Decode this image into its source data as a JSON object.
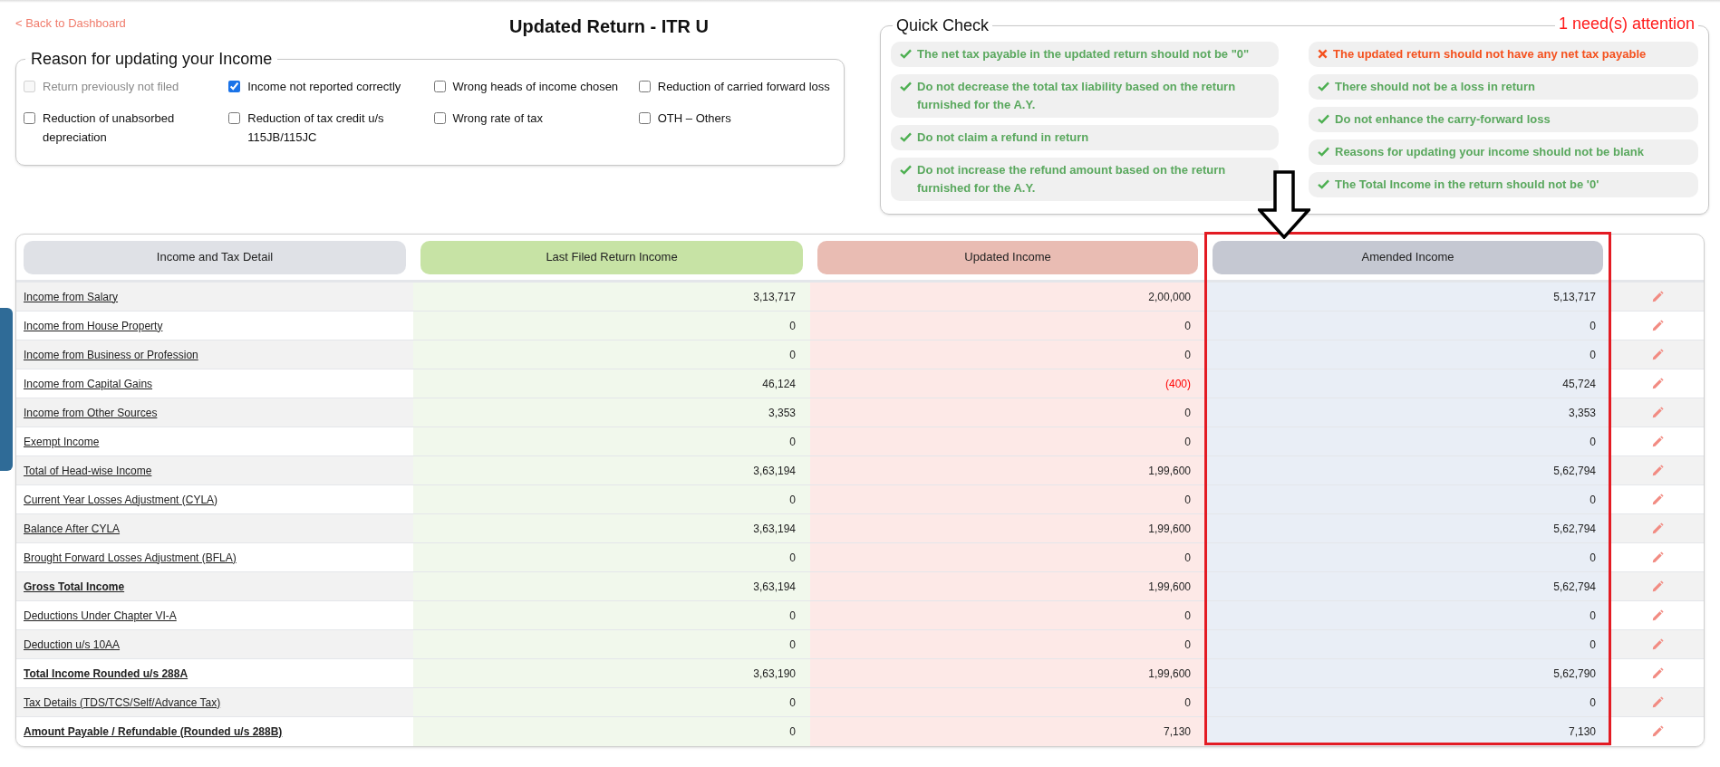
{
  "back_link": "< Back to Dashboard",
  "title": "Updated Return - ITR U",
  "reasons": {
    "legend": "Reason for updating your Income",
    "options": [
      {
        "label": "Return previously not filed",
        "checked": false,
        "disabled": true
      },
      {
        "label": "Income not reported correctly",
        "checked": true,
        "disabled": false
      },
      {
        "label": "Wrong heads of income chosen",
        "checked": false,
        "disabled": false
      },
      {
        "label": "Reduction of carried forward loss",
        "checked": false,
        "disabled": false
      },
      {
        "label": "Reduction of unabsorbed depreciation",
        "checked": false,
        "disabled": false
      },
      {
        "label": "Reduction of tax credit u/s 115JB/115JC",
        "checked": false,
        "disabled": false
      },
      {
        "label": "Wrong rate of tax",
        "checked": false,
        "disabled": false
      },
      {
        "label": "OTH – Others",
        "checked": false,
        "disabled": false
      }
    ]
  },
  "quick_check": {
    "legend": "Quick Check",
    "attention": "1 need(s) attention",
    "columns": [
      [
        {
          "text": "The net tax payable in the updated return should not be \"0\"",
          "passed": true
        },
        {
          "text": "Do not decrease the total tax liability based on the return furnished for the A.Y.",
          "passed": true
        },
        {
          "text": "Do not claim a refund in return",
          "passed": true
        },
        {
          "text": "Do not increase the refund amount based on the return furnished for the A.Y.",
          "passed": true
        }
      ],
      [
        {
          "text": "The updated return should not have any net tax payable",
          "passed": false
        },
        {
          "text": "There should not be a loss in return",
          "passed": true
        },
        {
          "text": "Do not enhance the carry-forward loss",
          "passed": true
        },
        {
          "text": "Reasons for updating your income should not be blank",
          "passed": true
        },
        {
          "text": "The Total Income in the return should not be '0'",
          "passed": true
        }
      ]
    ]
  },
  "table": {
    "columns": [
      {
        "label": "Income and Tax Detail",
        "kind": "label"
      },
      {
        "label": "Last Filed Return Income",
        "kind": "last"
      },
      {
        "label": "Updated Income",
        "kind": "updated"
      },
      {
        "label": "Amended Income",
        "kind": "amended"
      }
    ],
    "rows": [
      {
        "label": "Income from Salary",
        "bold": false,
        "values": [
          {
            "text": "3,13,717",
            "negative": false
          },
          {
            "text": "2,00,000",
            "negative": false
          },
          {
            "text": "5,13,717",
            "negative": false
          }
        ]
      },
      {
        "label": "Income from House Property",
        "bold": false,
        "values": [
          {
            "text": "0",
            "negative": false
          },
          {
            "text": "0",
            "negative": false
          },
          {
            "text": "0",
            "negative": false
          }
        ]
      },
      {
        "label": "Income from Business or Profession",
        "bold": false,
        "values": [
          {
            "text": "0",
            "negative": false
          },
          {
            "text": "0",
            "negative": false
          },
          {
            "text": "0",
            "negative": false
          }
        ]
      },
      {
        "label": "Income from Capital Gains",
        "bold": false,
        "values": [
          {
            "text": "46,124",
            "negative": false
          },
          {
            "text": "(400)",
            "negative": true
          },
          {
            "text": "45,724",
            "negative": false
          }
        ]
      },
      {
        "label": "Income from Other Sources",
        "bold": false,
        "values": [
          {
            "text": "3,353",
            "negative": false
          },
          {
            "text": "0",
            "negative": false
          },
          {
            "text": "3,353",
            "negative": false
          }
        ]
      },
      {
        "label": "Exempt Income",
        "bold": false,
        "values": [
          {
            "text": "0",
            "negative": false
          },
          {
            "text": "0",
            "negative": false
          },
          {
            "text": "0",
            "negative": false
          }
        ]
      },
      {
        "label": "Total of Head-wise Income",
        "bold": false,
        "values": [
          {
            "text": "3,63,194",
            "negative": false
          },
          {
            "text": "1,99,600",
            "negative": false
          },
          {
            "text": "5,62,794",
            "negative": false
          }
        ]
      },
      {
        "label": "Current Year Losses Adjustment (CYLA)",
        "bold": false,
        "values": [
          {
            "text": "0",
            "negative": false
          },
          {
            "text": "0",
            "negative": false
          },
          {
            "text": "0",
            "negative": false
          }
        ]
      },
      {
        "label": "Balance After CYLA",
        "bold": false,
        "values": [
          {
            "text": "3,63,194",
            "negative": false
          },
          {
            "text": "1,99,600",
            "negative": false
          },
          {
            "text": "5,62,794",
            "negative": false
          }
        ]
      },
      {
        "label": "Brought Forward Losses Adjustment (BFLA)",
        "bold": false,
        "values": [
          {
            "text": "0",
            "negative": false
          },
          {
            "text": "0",
            "negative": false
          },
          {
            "text": "0",
            "negative": false
          }
        ]
      },
      {
        "label": "Gross Total Income",
        "bold": true,
        "values": [
          {
            "text": "3,63,194",
            "negative": false
          },
          {
            "text": "1,99,600",
            "negative": false
          },
          {
            "text": "5,62,794",
            "negative": false
          }
        ]
      },
      {
        "label": "Deductions Under Chapter VI-A",
        "bold": false,
        "values": [
          {
            "text": "0",
            "negative": false
          },
          {
            "text": "0",
            "negative": false
          },
          {
            "text": "0",
            "negative": false
          }
        ]
      },
      {
        "label": "Deduction u/s 10AA",
        "bold": false,
        "values": [
          {
            "text": "0",
            "negative": false
          },
          {
            "text": "0",
            "negative": false
          },
          {
            "text": "0",
            "negative": false
          }
        ]
      },
      {
        "label": "Total Income Rounded u/s 288A",
        "bold": true,
        "values": [
          {
            "text": "3,63,190",
            "negative": false
          },
          {
            "text": "1,99,600",
            "negative": false
          },
          {
            "text": "5,62,790",
            "negative": false
          }
        ]
      },
      {
        "label": "Tax Details (TDS/TCS/Self/Advance Tax)",
        "bold": false,
        "values": [
          {
            "text": "0",
            "negative": false
          },
          {
            "text": "0",
            "negative": false
          },
          {
            "text": "0",
            "negative": false
          }
        ]
      },
      {
        "label": "Amount Payable / Refundable (Rounded u/s 288B)",
        "bold": true,
        "values": [
          {
            "text": "0",
            "negative": false
          },
          {
            "text": "7,130",
            "negative": false
          },
          {
            "text": "7,130",
            "negative": false
          }
        ]
      }
    ]
  }
}
